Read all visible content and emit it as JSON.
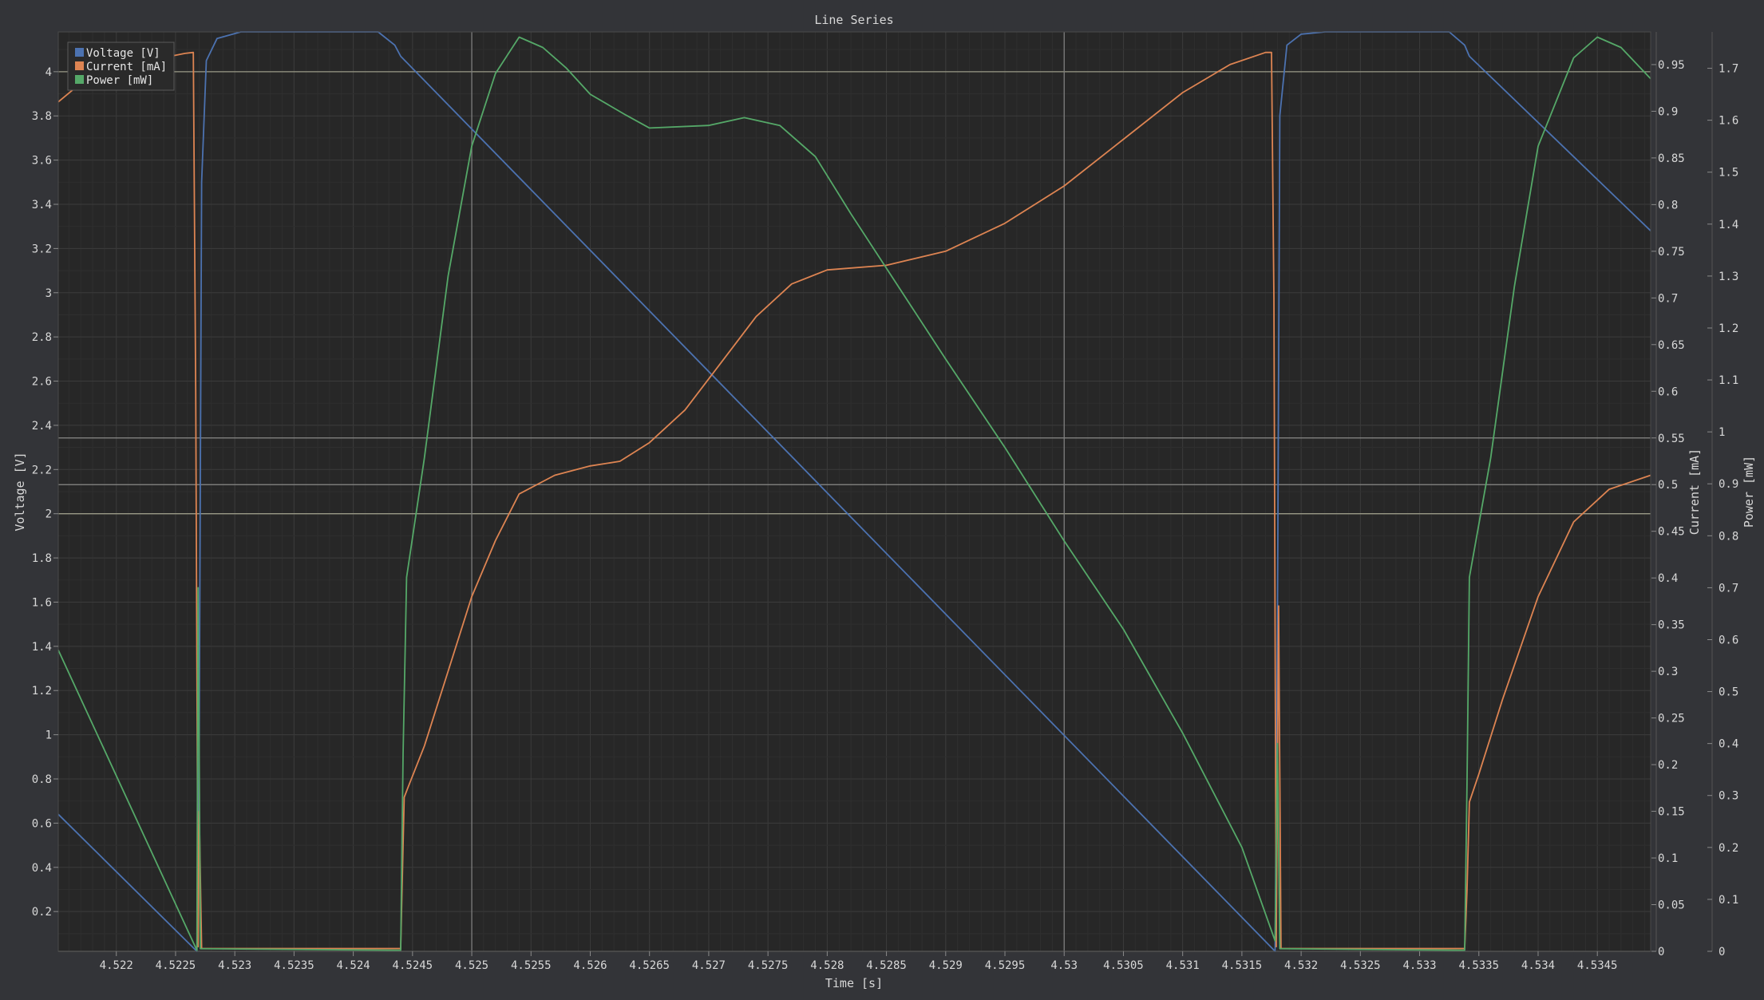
{
  "chart_data": {
    "type": "line",
    "title": "Line Series",
    "xlabel": "Time [s]",
    "xlim": [
      4.52151,
      4.53495
    ],
    "x_ticks": [
      "4.522",
      "4.5225",
      "4.523",
      "4.5235",
      "4.524",
      "4.5245",
      "4.525",
      "4.5255",
      "4.526",
      "4.5265",
      "4.527",
      "4.5275",
      "4.528",
      "4.5285",
      "4.529",
      "4.5295",
      "4.53",
      "4.5305",
      "4.531",
      "4.5315",
      "4.532",
      "4.5325",
      "4.533",
      "4.5335",
      "4.534",
      "4.5345"
    ],
    "grid": true,
    "legend_position": "top-left",
    "axes": [
      {
        "id": "voltage",
        "label": "Voltage [V]",
        "side": "left",
        "ylim": [
          0.02,
          4.18
        ],
        "ticks": [
          "0.2",
          "0.4",
          "0.6",
          "0.8",
          "1",
          "1.2",
          "1.4",
          "1.6",
          "1.8",
          "2",
          "2.2",
          "2.4",
          "2.6",
          "2.8",
          "3",
          "3.2",
          "3.4",
          "3.6",
          "3.8",
          "4"
        ]
      },
      {
        "id": "current",
        "label": "Current [mA]",
        "side": "right",
        "ylim": [
          0,
          0.985
        ],
        "ticks": [
          "0",
          "0.05",
          "0.1",
          "0.15",
          "0.2",
          "0.25",
          "0.3",
          "0.35",
          "0.4",
          "0.45",
          "0.5",
          "0.55",
          "0.6",
          "0.65",
          "0.7",
          "0.75",
          "0.8",
          "0.85",
          "0.9",
          "0.95"
        ]
      },
      {
        "id": "power",
        "label": "Power [mW]",
        "side": "right",
        "ylim": [
          0,
          1.77
        ],
        "ticks": [
          "0",
          "0.1",
          "0.2",
          "0.3",
          "0.4",
          "0.5",
          "0.6",
          "0.7",
          "0.8",
          "0.9",
          "1",
          "1.1",
          "1.2",
          "1.3",
          "1.4",
          "1.5",
          "1.6",
          "1.7"
        ]
      }
    ],
    "series": [
      {
        "name": "Voltage [V]",
        "axis": "voltage",
        "color": "#4c72b0",
        "points": [
          [
            4.52151,
            0.64
          ],
          [
            4.52268,
            0.02
          ],
          [
            4.5227,
            1.0
          ],
          [
            4.52272,
            3.5
          ],
          [
            4.52276,
            4.05
          ],
          [
            4.52285,
            4.15
          ],
          [
            4.52305,
            4.18
          ],
          [
            4.52421,
            4.18
          ],
          [
            4.52435,
            4.12
          ],
          [
            4.5244,
            4.07
          ],
          [
            4.53178,
            0.02
          ],
          [
            4.5318,
            1.5
          ],
          [
            4.53182,
            3.8
          ],
          [
            4.53188,
            4.12
          ],
          [
            4.532,
            4.17
          ],
          [
            4.5322,
            4.18
          ],
          [
            4.53325,
            4.18
          ],
          [
            4.53338,
            4.12
          ],
          [
            4.53342,
            4.07
          ],
          [
            4.53495,
            3.28
          ]
        ]
      },
      {
        "name": "Current [mA]",
        "axis": "current",
        "color": "#dd8452",
        "points": [
          [
            4.52151,
            0.91
          ],
          [
            4.5217,
            0.93
          ],
          [
            4.522,
            0.945
          ],
          [
            4.5223,
            0.955
          ],
          [
            4.52258,
            0.962
          ],
          [
            4.52265,
            0.963
          ],
          [
            4.52267,
            0.6
          ],
          [
            4.52269,
            0.005
          ],
          [
            4.5227,
            0.15
          ],
          [
            4.52272,
            0.003
          ],
          [
            4.5244,
            0.003
          ],
          [
            4.52443,
            0.165
          ],
          [
            4.52446,
            0.175
          ],
          [
            4.5246,
            0.22
          ],
          [
            4.5248,
            0.3
          ],
          [
            4.525,
            0.38
          ],
          [
            4.5252,
            0.44
          ],
          [
            4.5254,
            0.49
          ],
          [
            4.5257,
            0.51
          ],
          [
            4.526,
            0.52
          ],
          [
            4.52625,
            0.525
          ],
          [
            4.5265,
            0.545
          ],
          [
            4.5268,
            0.58
          ],
          [
            4.5271,
            0.63
          ],
          [
            4.5274,
            0.68
          ],
          [
            4.5277,
            0.715
          ],
          [
            4.528,
            0.73
          ],
          [
            4.5285,
            0.735
          ],
          [
            4.529,
            0.75
          ],
          [
            4.5295,
            0.78
          ],
          [
            4.53,
            0.82
          ],
          [
            4.5305,
            0.87
          ],
          [
            4.531,
            0.92
          ],
          [
            4.5314,
            0.95
          ],
          [
            4.5317,
            0.963
          ],
          [
            4.53175,
            0.963
          ],
          [
            4.53177,
            0.7
          ],
          [
            4.53179,
            0.005
          ],
          [
            4.53181,
            0.37
          ],
          [
            4.53183,
            0.003
          ],
          [
            4.53338,
            0.003
          ],
          [
            4.5334,
            0.065
          ],
          [
            4.53342,
            0.16
          ],
          [
            4.5335,
            0.19
          ],
          [
            4.5337,
            0.27
          ],
          [
            4.534,
            0.38
          ],
          [
            4.5343,
            0.46
          ],
          [
            4.5346,
            0.495
          ],
          [
            4.53495,
            0.51
          ]
        ]
      },
      {
        "name": "Power [mW]",
        "axis": "power",
        "color": "#55a868",
        "points": [
          [
            4.52151,
            0.58
          ],
          [
            4.52268,
            0.002
          ],
          [
            4.52269,
            0.7
          ],
          [
            4.52271,
            0.005
          ],
          [
            4.5244,
            0.002
          ],
          [
            4.52442,
            0.38
          ],
          [
            4.52445,
            0.72
          ],
          [
            4.5246,
            0.95
          ],
          [
            4.5248,
            1.3
          ],
          [
            4.525,
            1.55
          ],
          [
            4.5252,
            1.69
          ],
          [
            4.5254,
            1.76
          ],
          [
            4.5256,
            1.74
          ],
          [
            4.5258,
            1.7
          ],
          [
            4.526,
            1.65
          ],
          [
            4.5263,
            1.61
          ],
          [
            4.5265,
            1.585
          ],
          [
            4.527,
            1.59
          ],
          [
            4.5273,
            1.605
          ],
          [
            4.5276,
            1.59
          ],
          [
            4.5279,
            1.53
          ],
          [
            4.5282,
            1.42
          ],
          [
            4.5286,
            1.28
          ],
          [
            4.529,
            1.14
          ],
          [
            4.5295,
            0.97
          ],
          [
            4.53,
            0.79
          ],
          [
            4.5305,
            0.62
          ],
          [
            4.531,
            0.42
          ],
          [
            4.5315,
            0.2
          ],
          [
            4.53178,
            0.02
          ],
          [
            4.5318,
            0.4
          ],
          [
            4.53182,
            0.005
          ],
          [
            4.53338,
            0.002
          ],
          [
            4.5334,
            0.32
          ],
          [
            4.53342,
            0.72
          ],
          [
            4.5336,
            0.95
          ],
          [
            4.5338,
            1.28
          ],
          [
            4.534,
            1.55
          ],
          [
            4.5343,
            1.72
          ],
          [
            4.5345,
            1.76
          ],
          [
            4.5347,
            1.74
          ],
          [
            4.53495,
            1.68
          ]
        ]
      }
    ],
    "reference_lines": [
      {
        "axis": "voltage",
        "value": 4.0,
        "color": "#9a9a86"
      },
      {
        "axis": "voltage",
        "value": 2.0,
        "color": "#9a9a86"
      },
      {
        "axis": "current",
        "value": 0.55,
        "color": "#8a8a88"
      },
      {
        "axis": "current",
        "value": 0.5,
        "color": "#8a8a88"
      },
      {
        "axis": "power",
        "value": 0.0,
        "color": "#8a8a88"
      }
    ],
    "vertical_markers": [
      {
        "x": 4.525,
        "color": "#7d7d7d"
      },
      {
        "x": 4.53,
        "color": "#7d7d7d"
      }
    ],
    "colors": {
      "background": "#333438",
      "plot_bg": "#272727",
      "grid": "#3b3b3b",
      "text": "#d8d8d8"
    }
  }
}
